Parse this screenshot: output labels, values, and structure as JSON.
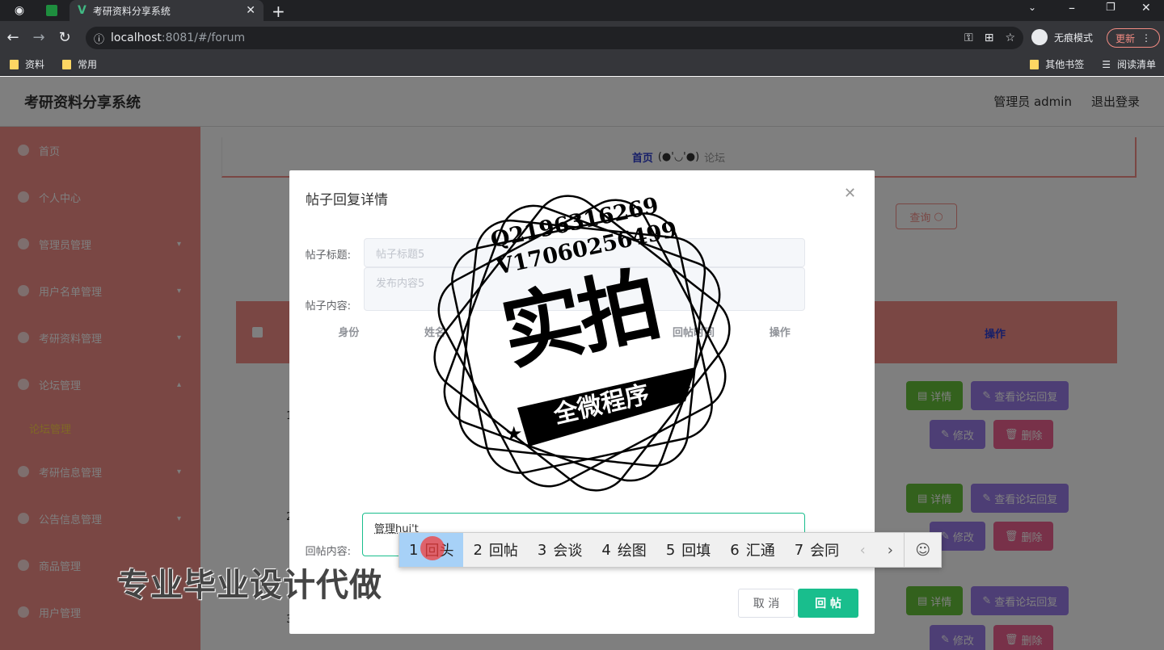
{
  "browser": {
    "active_tab_title": "考研资料分享系统",
    "url_host": "localhost",
    "url_rest": ":8081/#/forum",
    "incognito_label": "无痕模式",
    "update_label": "更新",
    "bookmarks": [
      "资料",
      "常用"
    ],
    "bookmarks_right": [
      "其他书签",
      "阅读清单"
    ]
  },
  "app": {
    "title": "考研资料分享系统",
    "user_label": "管理员 admin",
    "logout_label": "退出登录",
    "breadcrumb_home": "首页",
    "breadcrumb_face": "(●'◡'●)",
    "breadcrumb_current": "论坛",
    "search_button": "查询",
    "table_header_action": "操作",
    "sidebar_items": [
      "首页",
      "个人中心",
      "管理员管理",
      "用户名单管理",
      "考研资料管理",
      "论坛管理",
      "",
      "考研信息管理",
      "公告信息管理",
      "商品管理",
      "用户管理"
    ],
    "sidebar_sub_active": "论坛管理",
    "row_numbers": [
      "1",
      "2",
      "3"
    ],
    "row_buttons": {
      "detail": "详情",
      "view_reply": "查看论坛回复",
      "edit": "修改",
      "delete": "删除"
    }
  },
  "dialog": {
    "title": "帖子回复详情",
    "label_title": "帖子标题:",
    "label_content": "帖子内容:",
    "title_placeholder": "帖子标题5",
    "content_placeholder": "发布内容5",
    "reply_table_headers": [
      "身份",
      "姓名",
      "",
      "",
      "回帖时间",
      "操作"
    ],
    "label_reply": "回帖内容:",
    "reply_value": "管理hui't",
    "cancel_label": "取 消",
    "submit_label": "回 帖"
  },
  "ime": {
    "candidates": [
      {
        "n": "1",
        "text": "回头"
      },
      {
        "n": "2",
        "text": "回帖"
      },
      {
        "n": "3",
        "text": "会谈"
      },
      {
        "n": "4",
        "text": "绘图"
      },
      {
        "n": "5",
        "text": "回填"
      },
      {
        "n": "6",
        "text": "汇通"
      },
      {
        "n": "7",
        "text": "会同"
      }
    ]
  },
  "watermark": {
    "line1": "Q2196316269",
    "line2": "V17060256499",
    "big": "实拍",
    "ribbon": "全微程序",
    "bottom": "专业毕业设计代做"
  }
}
